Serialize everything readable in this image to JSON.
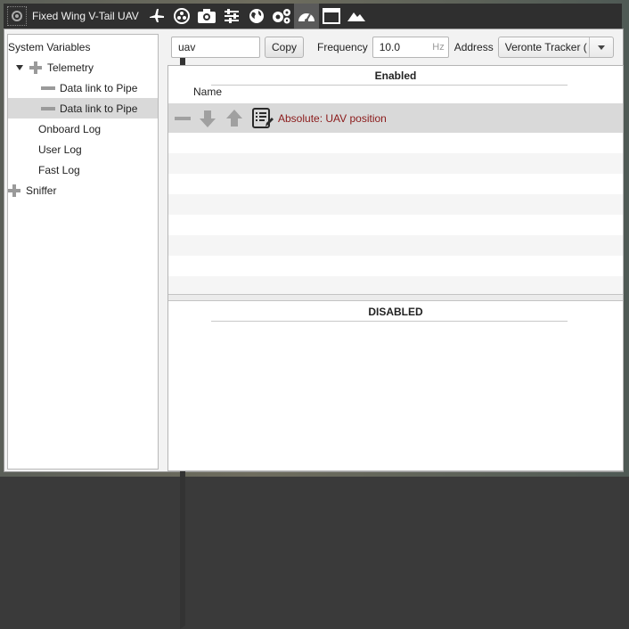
{
  "toolbar": {
    "title": "Fixed Wing V-Tail UAV",
    "icons": [
      "airplane-icon",
      "radiation-icon",
      "camera-icon",
      "sliders-icon",
      "globe-icon",
      "gears-icon",
      "gauge-icon",
      "window-icon",
      "mountain-icon"
    ],
    "active_icon": "gauge-icon"
  },
  "tree": {
    "items": [
      {
        "label": "System Variables",
        "expander": "collapsed"
      },
      {
        "label": "Telemetry",
        "expander": "expanded"
      },
      {
        "label": "Data link to Pipe"
      },
      {
        "label": "Data link to Pipe",
        "selected": true
      },
      {
        "label": "Onboard Log"
      },
      {
        "label": "User Log"
      },
      {
        "label": "Fast Log"
      },
      {
        "label": "Sniffer",
        "expander": "collapsed"
      }
    ]
  },
  "filter": {
    "name_value": "uav",
    "copy_label": "Copy",
    "frequency_label": "Frequency",
    "frequency_value": "10.0",
    "frequency_unit": "Hz",
    "address_label": "Address",
    "address_value": "Veronte Tracker ("
  },
  "enabled": {
    "header": "Enabled",
    "column_name": "Name",
    "rows": [
      {
        "name": "Absolute: UAV position",
        "selected": true
      }
    ]
  },
  "disabled": {
    "header": "DISABLED"
  },
  "colors": {
    "accent_text": "#8b1a1a",
    "toolbar_bg": "#2f2f2f",
    "selection_bg": "#d9d9d9"
  }
}
